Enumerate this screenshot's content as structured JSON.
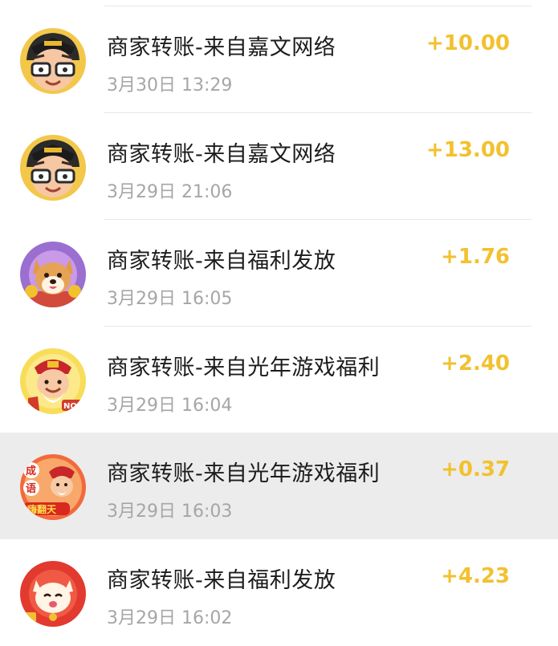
{
  "transactions": [
    {
      "title": "商家转账-来自嘉文网络",
      "time": "3月30日 13:29",
      "amount": "+10.00",
      "avatar": "official-cartoon-avatar"
    },
    {
      "title": "商家转账-来自嘉文网络",
      "time": "3月29日 21:06",
      "amount": "+13.00",
      "avatar": "official-cartoon-avatar"
    },
    {
      "title": "商家转账-来自福利发放",
      "time": "3月29日 16:05",
      "amount": "+1.76",
      "avatar": "shiba-dog-avatar"
    },
    {
      "title": "商家转账-来自光年游戏福利",
      "time": "3月29日 16:04",
      "amount": "+2.40",
      "avatar": "fortune-god-avatar"
    },
    {
      "title": "商家转账-来自光年游戏福利",
      "time": "3月29日 16:03",
      "amount": "+0.37",
      "avatar": "idiom-game-avatar",
      "badge_text": [
        "成",
        "语",
        "嗨翻天"
      ]
    },
    {
      "title": "商家转账-来自福利发放",
      "time": "3月29日 16:02",
      "amount": "+4.23",
      "avatar": "lucky-cat-avatar"
    }
  ],
  "colors": {
    "amount": "#f2c12e",
    "title": "#1c1c1c",
    "time": "#a6a6a6",
    "selected_row": "#ececec"
  }
}
